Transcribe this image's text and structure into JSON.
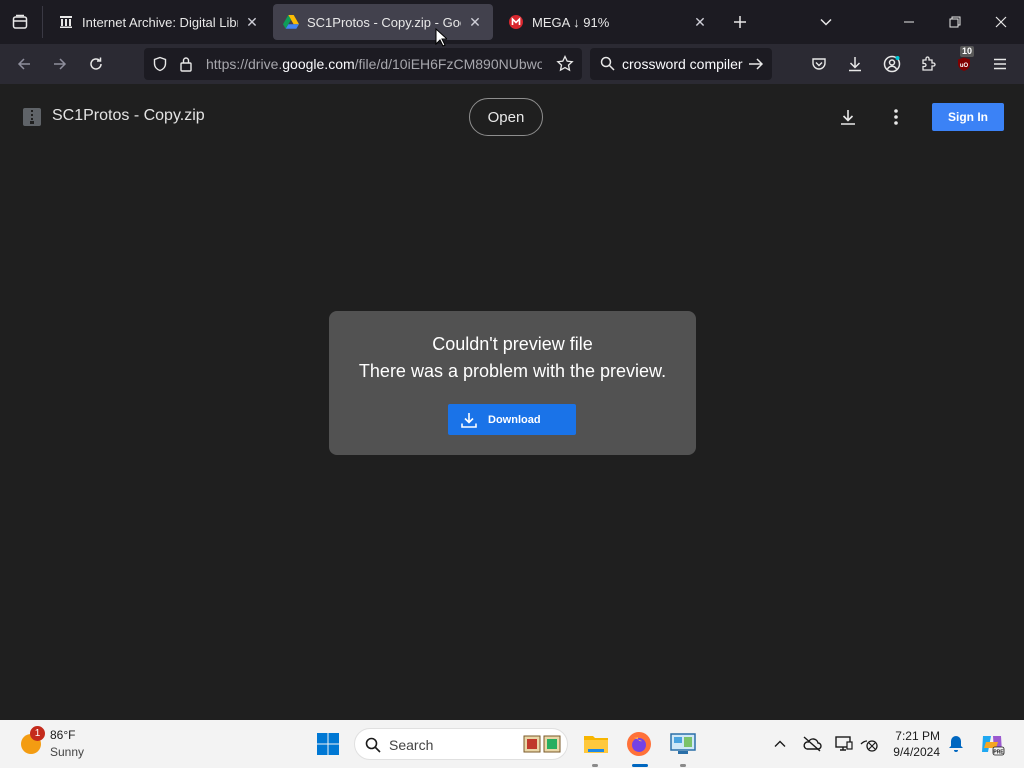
{
  "browser": {
    "tabs": [
      {
        "title": "Internet Archive: Digital Library",
        "active": false,
        "favicon": "archive-icon"
      },
      {
        "title": "SC1Protos - Copy.zip - Google",
        "active": true,
        "favicon": "google-drive-icon"
      },
      {
        "title": "MEGA ↓ 91%",
        "active": false,
        "favicon": "mega-icon"
      }
    ],
    "url_prefix": "https://drive.",
    "url_domain": "google.com",
    "url_path": "/file/d/10iEH6FzCM890NUbwo",
    "search_text": "crossword compiler",
    "extensions_badge": "10",
    "colors": {
      "tabbar": "#1c1b22",
      "navbar": "#2b2a33",
      "active_tab": "#42414d"
    }
  },
  "drive": {
    "file_name": "SC1Protos - Copy.zip",
    "open_label": "Open",
    "sign_in_label": "Sign In",
    "error_title": "Couldn't preview file",
    "error_message": "There was a problem with the preview.",
    "download_label": "Download",
    "colors": {
      "page_bg": "#1f1f1f",
      "card_bg": "#525252",
      "button_blue": "#1a73e8",
      "sign_in_blue": "#3b82f6"
    }
  },
  "taskbar": {
    "weather_temp": "86°F",
    "weather_cond": "Sunny",
    "weather_badge": "1",
    "search_label": "Search",
    "time": "7:21 PM",
    "date": "9/4/2024"
  }
}
